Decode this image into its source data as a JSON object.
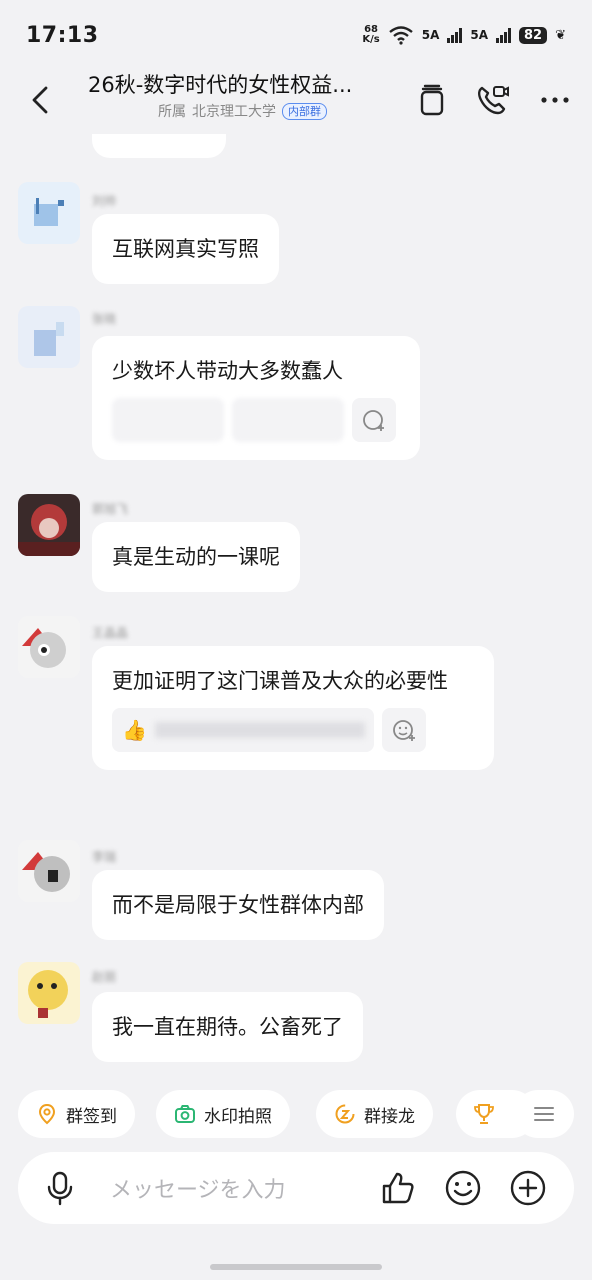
{
  "status_bar": {
    "time": "17:13",
    "net_speed_value": "68",
    "net_speed_unit": "K/s",
    "sim1_label": "5A",
    "sim2_label": "5A",
    "battery": "82"
  },
  "header": {
    "title": "26秋-数字时代的女性权益...",
    "affiliation_prefix": "所属",
    "affiliation": "北京理工大学",
    "badge": "内部群"
  },
  "messages": [
    {
      "sender": "刘帅",
      "text": "互联网真实写照",
      "has_reactions": false
    },
    {
      "sender": "张晓",
      "text": "少数坏人带动大多数蠢人",
      "has_reactions": true
    },
    {
      "sender": "郭旭飞",
      "text": "真是生动的一课呢",
      "has_reactions": false
    },
    {
      "sender": "王晶晶",
      "text": "更加证明了这门课普及大众的必要性",
      "has_reactions": true
    },
    {
      "sender": "李瑞",
      "text": "而不是局限于女性群体内部",
      "has_reactions": false
    },
    {
      "sender": "赵丽",
      "text": "我一直在期待。公畜死了",
      "has_reactions": false
    }
  ],
  "quick_actions": [
    {
      "label": "群签到",
      "icon": "location-pin-icon",
      "color": "#f0a020"
    },
    {
      "label": "水印拍照",
      "icon": "camera-icon",
      "color": "#2bb673"
    },
    {
      "label": "群接龙",
      "icon": "relay-icon",
      "color": "#f0a020"
    },
    {
      "label": "",
      "icon": "trophy-icon",
      "color": "#f0a020"
    }
  ],
  "input": {
    "placeholder": "メッセージを入力"
  },
  "colors": {
    "background": "#f2f2f4",
    "bubble": "#ffffff",
    "accent_orange": "#f0a020",
    "accent_green": "#2bb673",
    "badge_blue": "#3a6fe0"
  }
}
